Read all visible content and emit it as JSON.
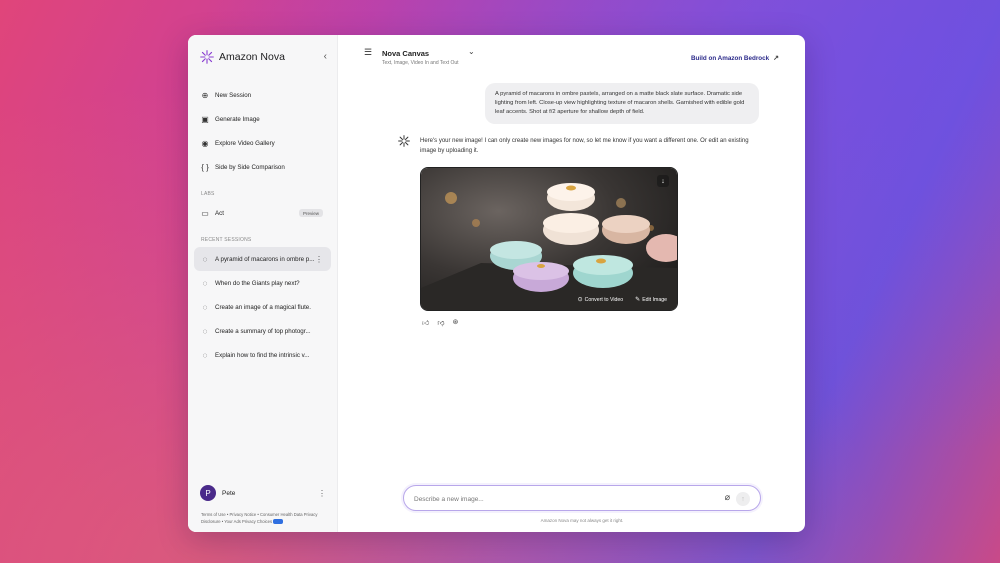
{
  "sidebar": {
    "brand": "Amazon Nova",
    "collapse_icon": "chevron-left-icon",
    "nav": [
      {
        "label": "New Session",
        "icon": "new-session-icon"
      },
      {
        "label": "Generate Image",
        "icon": "image-icon"
      },
      {
        "label": "Explore Video Gallery",
        "icon": "video-icon"
      },
      {
        "label": "Side by Side Comparison",
        "icon": "braces-icon"
      }
    ],
    "labs_label": "LABS",
    "labs": [
      {
        "label": "Act",
        "badge": "Preview",
        "icon": "browser-icon"
      }
    ],
    "recent_label": "RECENT SESSIONS",
    "recent": [
      {
        "label": "A pyramid of macarons in ombre p..."
      },
      {
        "label": "When do the Giants play next?"
      },
      {
        "label": "Create an image of a magical flute."
      },
      {
        "label": "Create a summary of top photogr..."
      },
      {
        "label": "Explain how to find the intrinsic v..."
      }
    ],
    "user": {
      "initial": "P",
      "name": "Pete"
    },
    "footer_links": "Terms of Use • Privacy Notice • Consumer Health Data Privacy Disclosure • Your Ads Privacy Choices"
  },
  "header": {
    "model_name": "Nova Canvas",
    "model_sub": "Text, Image, Video In and Text Out",
    "bedrock_link": "Build on Amazon Bedrock"
  },
  "conversation": {
    "user_prompt": "A pyramid of macarons in ombre pastels, arranged on a matte black slate surface. Dramatic side lighting from left. Close-up view highlighting texture of macaron shells. Garnished with edible gold leaf accents. Shot at f/2 aperture for shallow depth of field.",
    "assistant_reply": "Here's your new image! I can only create new images for now, so let me know if you want a different one. Or edit an existing image by uploading it.",
    "image_actions": {
      "convert": "Convert to Video",
      "edit": "Edit Image"
    }
  },
  "composer": {
    "placeholder": "Describe a new image...",
    "disclaimer": "Amazon Nova may not always get it right."
  },
  "colors": {
    "accent": "#2b2a8a",
    "avatar": "#4a2a8a",
    "composer_border": "#b8a7ea"
  }
}
